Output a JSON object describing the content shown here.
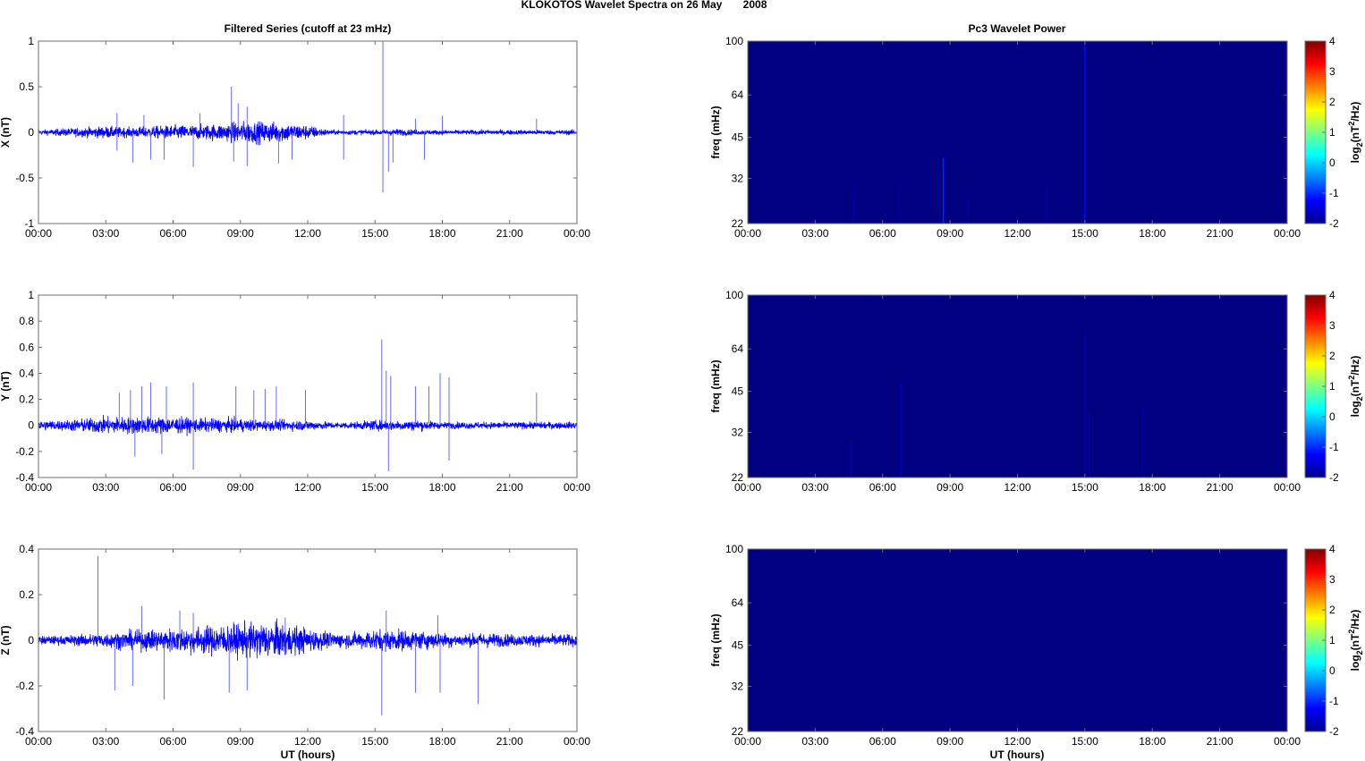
{
  "figure_title": "KLOKOTOS Wavelet Spectra on 26 May       2008",
  "left_title": "Filtered Series (cutoff at 23 mHz)",
  "right_title": "Pc3 Wavelet Power",
  "xlabel": "UT (hours)",
  "colors": {
    "trace": "#0000ff",
    "axis": "#6e6e6e"
  },
  "chart_data": [
    {
      "type": "line",
      "panel": "X",
      "ylabel": "X (nT)",
      "ylim": [
        -1,
        1
      ],
      "yticks": [
        -1,
        -0.5,
        0,
        0.5,
        1
      ],
      "yticklabels": [
        "-1",
        "-0.5",
        "0",
        "0.5",
        "1"
      ],
      "xlim": [
        0,
        24
      ],
      "xticks": [
        0,
        3,
        6,
        9,
        12,
        15,
        18,
        21,
        24
      ],
      "xticklabels": [
        "00:00",
        "03:00",
        "06:00",
        "09:00",
        "12:00",
        "15:00",
        "18:00",
        "21:00",
        "00:00"
      ],
      "envelope_hourly": [
        0.02,
        0.03,
        0.04,
        0.05,
        0.04,
        0.05,
        0.06,
        0.06,
        0.07,
        0.09,
        0.09,
        0.08,
        0.06,
        0.02,
        0.02,
        0.02,
        0.03,
        0.02,
        0.02,
        0.02,
        0.02,
        0.02,
        0.02,
        0.02,
        0.02
      ],
      "spikes": [
        [
          3.5,
          0.21
        ],
        [
          3.5,
          -0.2
        ],
        [
          4.2,
          -0.33
        ],
        [
          4.7,
          0.19
        ],
        [
          5.0,
          -0.3
        ],
        [
          5.6,
          -0.3
        ],
        [
          6.9,
          -0.38
        ],
        [
          7.2,
          0.21
        ],
        [
          8.6,
          0.5
        ],
        [
          8.7,
          -0.32
        ],
        [
          8.9,
          0.32
        ],
        [
          9.3,
          0.28
        ],
        [
          9.3,
          -0.37
        ],
        [
          10.7,
          -0.34
        ],
        [
          11.3,
          -0.3
        ],
        [
          13.6,
          0.19
        ],
        [
          13.6,
          -0.3
        ],
        [
          15.35,
          1.0
        ],
        [
          15.35,
          -0.66
        ],
        [
          15.6,
          -0.43
        ],
        [
          15.8,
          -0.33
        ],
        [
          16.8,
          0.15
        ],
        [
          17.2,
          -0.3
        ],
        [
          18.0,
          0.18
        ],
        [
          22.2,
          0.15
        ]
      ]
    },
    {
      "type": "line",
      "panel": "Y",
      "ylabel": "Y (nT)",
      "ylim": [
        -0.4,
        1
      ],
      "yticks": [
        -0.4,
        -0.2,
        0,
        0.2,
        0.4,
        0.6,
        0.8,
        1
      ],
      "yticklabels": [
        "-0.4",
        "-0.2",
        "0",
        "0.2",
        "0.4",
        "0.6",
        "0.8",
        "1"
      ],
      "xlim": [
        0,
        24
      ],
      "xticks": [
        0,
        3,
        6,
        9,
        12,
        15,
        18,
        21,
        24
      ],
      "xticklabels": [
        "00:00",
        "03:00",
        "06:00",
        "09:00",
        "12:00",
        "15:00",
        "18:00",
        "21:00",
        "00:00"
      ],
      "envelope_hourly": [
        0.03,
        0.03,
        0.04,
        0.05,
        0.05,
        0.05,
        0.05,
        0.04,
        0.04,
        0.04,
        0.03,
        0.03,
        0.03,
        0.02,
        0.02,
        0.03,
        0.03,
        0.03,
        0.02,
        0.02,
        0.02,
        0.02,
        0.02,
        0.02,
        0.02
      ],
      "spikes": [
        [
          3.6,
          0.25
        ],
        [
          4.1,
          0.27
        ],
        [
          4.3,
          -0.24
        ],
        [
          4.6,
          0.3
        ],
        [
          5.0,
          0.33
        ],
        [
          5.5,
          -0.22
        ],
        [
          5.7,
          0.3
        ],
        [
          6.9,
          0.33
        ],
        [
          6.9,
          -0.34
        ],
        [
          8.8,
          0.3
        ],
        [
          9.6,
          0.27
        ],
        [
          10.1,
          0.28
        ],
        [
          10.6,
          0.3
        ],
        [
          11.9,
          0.27
        ],
        [
          15.3,
          0.66
        ],
        [
          15.5,
          0.42
        ],
        [
          15.6,
          -0.35
        ],
        [
          15.7,
          0.38
        ],
        [
          16.8,
          0.3
        ],
        [
          17.4,
          0.3
        ],
        [
          17.9,
          0.4
        ],
        [
          18.3,
          0.37
        ],
        [
          18.3,
          -0.27
        ],
        [
          22.2,
          0.25
        ]
      ]
    },
    {
      "type": "line",
      "panel": "Z",
      "ylabel": "Z (nT)",
      "ylim": [
        -0.4,
        0.4
      ],
      "yticks": [
        -0.4,
        -0.2,
        0,
        0.2,
        0.4
      ],
      "yticklabels": [
        "-0.4",
        "-0.2",
        "0",
        "0.2",
        "0.4"
      ],
      "xlim": [
        0,
        24
      ],
      "xticks": [
        0,
        3,
        6,
        9,
        12,
        15,
        18,
        21,
        24
      ],
      "xticklabels": [
        "00:00",
        "03:00",
        "06:00",
        "09:00",
        "12:00",
        "15:00",
        "18:00",
        "21:00",
        "00:00"
      ],
      "envelope_hourly": [
        0.015,
        0.015,
        0.02,
        0.025,
        0.03,
        0.035,
        0.04,
        0.045,
        0.05,
        0.055,
        0.06,
        0.055,
        0.04,
        0.025,
        0.025,
        0.035,
        0.035,
        0.03,
        0.025,
        0.02,
        0.025,
        0.02,
        0.02,
        0.02,
        0.02
      ],
      "spikes": [
        [
          2.65,
          0.37
        ],
        [
          3.4,
          -0.22
        ],
        [
          4.2,
          -0.2
        ],
        [
          4.6,
          0.15
        ],
        [
          5.6,
          -0.26
        ],
        [
          6.3,
          0.13
        ],
        [
          6.9,
          0.12
        ],
        [
          8.5,
          -0.23
        ],
        [
          9.3,
          -0.22
        ],
        [
          11.0,
          0.1
        ],
        [
          15.3,
          -0.33
        ],
        [
          15.5,
          0.13
        ],
        [
          16.8,
          -0.23
        ],
        [
          17.8,
          0.11
        ],
        [
          17.9,
          -0.23
        ],
        [
          19.6,
          -0.28
        ],
        [
          24,
          0.09
        ]
      ]
    },
    {
      "type": "heatmap",
      "panel": "X",
      "ylabel": "freq (mHz)",
      "yscale": "log",
      "ylim": [
        22,
        100
      ],
      "yticks": [
        22,
        32,
        45,
        64,
        100
      ],
      "yticklabels": [
        "22",
        "32",
        "45",
        "64",
        "100"
      ],
      "xlim": [
        0,
        24
      ],
      "xticks": [
        0,
        3,
        6,
        9,
        12,
        15,
        18,
        21,
        24
      ],
      "xticklabels": [
        "00:00",
        "03:00",
        "06:00",
        "09:00",
        "12:00",
        "15:00",
        "18:00",
        "21:00",
        "00:00"
      ],
      "background_level": -2,
      "streaks": [
        [
          4.7,
          30,
          -1.7
        ],
        [
          6.7,
          30,
          -1.8
        ],
        [
          8.7,
          38,
          -1.0
        ],
        [
          9.8,
          27,
          -1.8
        ],
        [
          13.3,
          30,
          -1.8
        ],
        [
          15.0,
          100,
          -1.2
        ]
      ],
      "clim": [
        -2,
        4
      ],
      "cticks": [
        "-2",
        "-1",
        "0",
        "1",
        "2",
        "3",
        "4"
      ],
      "clabel": "log2(nT2/Hz)"
    },
    {
      "type": "heatmap",
      "panel": "Y",
      "ylabel": "freq (mHz)",
      "yscale": "log",
      "ylim": [
        22,
        100
      ],
      "yticks": [
        22,
        32,
        45,
        64,
        100
      ],
      "yticklabels": [
        "22",
        "32",
        "45",
        "64",
        "100"
      ],
      "xlim": [
        0,
        24
      ],
      "xticks": [
        0,
        3,
        6,
        9,
        12,
        15,
        18,
        21,
        24
      ],
      "xticklabels": [
        "00:00",
        "03:00",
        "06:00",
        "09:00",
        "12:00",
        "15:00",
        "18:00",
        "21:00",
        "00:00"
      ],
      "background_level": -2,
      "streaks": [
        [
          4.6,
          30,
          -1.6
        ],
        [
          6.8,
          48,
          -1.5
        ],
        [
          15.0,
          75,
          -1.8
        ],
        [
          15.2,
          38,
          -1.7
        ],
        [
          17.6,
          40,
          -1.8
        ]
      ],
      "clim": [
        -2,
        4
      ],
      "cticks": [
        "-2",
        "-1",
        "0",
        "1",
        "2",
        "3",
        "4"
      ],
      "clabel": "log2(nT2/Hz)"
    },
    {
      "type": "heatmap",
      "panel": "Z",
      "ylabel": "freq (mHz)",
      "yscale": "log",
      "ylim": [
        22,
        100
      ],
      "yticks": [
        22,
        32,
        45,
        64,
        100
      ],
      "yticklabels": [
        "22",
        "32",
        "45",
        "64",
        "100"
      ],
      "xlim": [
        0,
        24
      ],
      "xticks": [
        0,
        3,
        6,
        9,
        12,
        15,
        18,
        21,
        24
      ],
      "xticklabels": [
        "00:00",
        "03:00",
        "06:00",
        "09:00",
        "12:00",
        "15:00",
        "18:00",
        "21:00",
        "00:00"
      ],
      "background_level": -2,
      "streaks": [],
      "clim": [
        -2,
        4
      ],
      "cticks": [
        "-2",
        "-1",
        "0",
        "1",
        "2",
        "3",
        "4"
      ],
      "clabel": "log2(nT2/Hz)"
    }
  ]
}
